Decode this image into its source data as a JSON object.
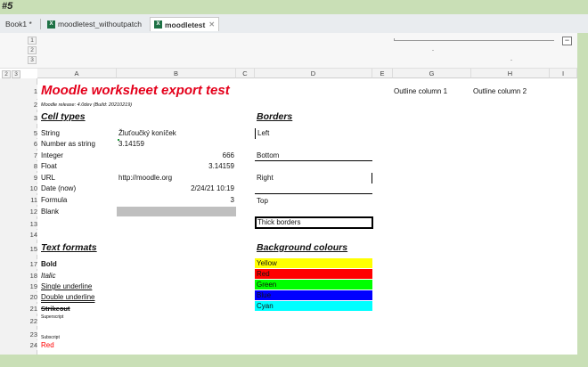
{
  "header": {
    "label": "#5"
  },
  "tabs": [
    {
      "label": "Book1 *"
    },
    {
      "label": "moodletest_withoutpatch"
    },
    {
      "label": "moodletest"
    }
  ],
  "outline": {
    "buttons": [
      "1",
      "2",
      "3"
    ],
    "row_buttons": [
      "2",
      "3"
    ],
    "collapse": "−"
  },
  "columns": [
    "A",
    "B",
    "C",
    "D",
    "E",
    "G",
    "H",
    "I"
  ],
  "rows": [
    "1",
    "2",
    "3",
    "5",
    "6",
    "7",
    "8",
    "9",
    "10",
    "11",
    "12",
    "13",
    "14",
    "15",
    "17",
    "18",
    "19",
    "20",
    "21",
    "22",
    "23",
    "24"
  ],
  "sheet": {
    "title": "Moodle worksheet export test",
    "release": "Moodle release: 4.0dev (Build: 20210219)",
    "cell_types": "Cell types",
    "borders": "Borders",
    "string_label": "String",
    "string_value": "Žluťoučký koníček",
    "numstr_label": "Number as string",
    "numstr_value": "3.14159",
    "integer_label": "Integer",
    "integer_value": "666",
    "float_label": "Float",
    "float_value": "3.14159",
    "url_label": "URL",
    "url_value": "http://moodle.org",
    "date_label": "Date (now)",
    "date_value": "2/24/21 10:19",
    "formula_label": "Formula",
    "formula_value": "3",
    "blank_label": "Blank",
    "left": "Left",
    "bottom": "Bottom",
    "right": "Right",
    "top": "Top",
    "thick": "Thick borders",
    "outline1": "Outline column 1",
    "outline2": "Outline column 2",
    "text_formats": "Text formats",
    "bg_colours": "Background colours",
    "bold": "Bold",
    "italic": "Italic",
    "single_underline": "Single underline",
    "double_underline": "Double underline",
    "strikeout": "Strikeout",
    "superscript": "Superscript",
    "subscript": "Subscript",
    "red": "Red"
  },
  "background_colours": [
    {
      "label": "Yellow",
      "color": "#ffff00"
    },
    {
      "label": "Red",
      "color": "#ff0000"
    },
    {
      "label": "Green",
      "color": "#00ff00"
    },
    {
      "label": "Blue",
      "color": "#0000ff"
    },
    {
      "label": "Cyan",
      "color": "#00ffff"
    }
  ]
}
